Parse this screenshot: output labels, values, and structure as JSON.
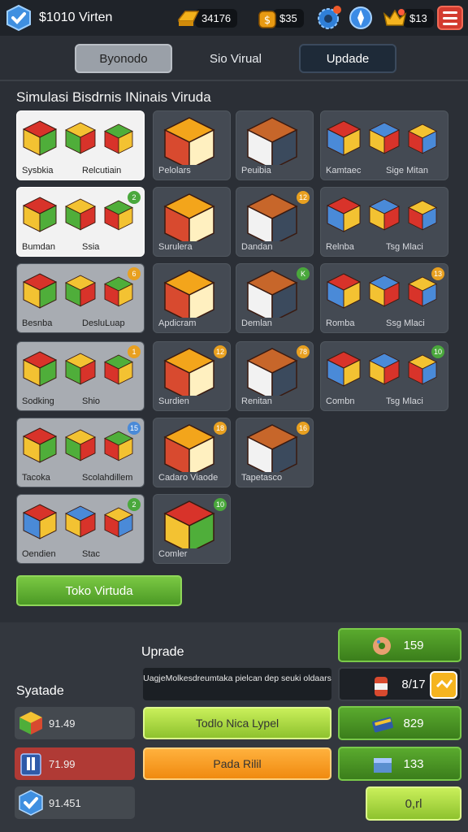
{
  "header": {
    "title": "$1010 Virten",
    "gold": "34176",
    "cash": "$35",
    "gems": "$13",
    "icons": [
      "verified-badge-icon",
      "gold-bar-icon",
      "coin-bag-icon",
      "settings-gear-icon",
      "compass-icon",
      "crown-coins-icon",
      "menu-icon"
    ]
  },
  "tabs": [
    {
      "label": "Byonodo"
    },
    {
      "label": "Sio Virual"
    },
    {
      "label": "Updade"
    }
  ],
  "section": {
    "title": "Simulasi Bisdrnis INinais Viruda"
  },
  "items": [
    {
      "labels": [
        "Sysbkia",
        "Relcutiain"
      ],
      "badge": ""
    },
    {
      "labels": [
        "Pelolars"
      ],
      "badge": ""
    },
    {
      "labels": [
        "Peuibia"
      ],
      "badge": ""
    },
    {
      "labels": [
        "Kamtaec",
        "Sige Mitan"
      ],
      "badge": ""
    },
    {
      "labels": [
        "Bumdan",
        "Ssia"
      ],
      "badge": "2"
    },
    {
      "labels": [
        "Surulera"
      ],
      "badge": ""
    },
    {
      "labels": [
        "Dandan"
      ],
      "badge": "12"
    },
    {
      "labels": [
        "Relnba",
        "Tsg Mlaci"
      ],
      "badge": ""
    },
    {
      "labels": [
        "Besnba",
        "DesluLuap"
      ],
      "badge": "6"
    },
    {
      "labels": [
        "Apdicram"
      ],
      "badge": ""
    },
    {
      "labels": [
        "Demlan"
      ],
      "badge": "K"
    },
    {
      "labels": [
        "Romba",
        "Ssg Mlaci"
      ],
      "badge": "13"
    },
    {
      "labels": [
        "Sodking",
        "Shio"
      ],
      "badge": "1"
    },
    {
      "labels": [
        "Surdien"
      ],
      "badge": "12"
    },
    {
      "labels": [
        "Renitan"
      ],
      "badge": "78"
    },
    {
      "labels": [
        "Combn",
        "Tsg Mlaci"
      ],
      "badge": "10"
    },
    {
      "labels": [
        "Tacoka",
        "Scolahdillem"
      ],
      "badge": "15"
    },
    {
      "labels": [
        "Cadaro Viaode"
      ],
      "badge": "18"
    },
    {
      "labels": [
        "Tapetasco"
      ],
      "badge": "16"
    },
    {
      "labels": [
        "Oendien",
        "Stac"
      ],
      "badge": "2"
    },
    {
      "labels": [
        "Comler"
      ],
      "badge": "10"
    }
  ],
  "main_button": "Toko Virtuda",
  "upgrade": {
    "title": "Uprade",
    "description": "UagjeMolkesdreumtaka pielcan dep seuki oldaars",
    "button_green": "Todlo Nica Lypel",
    "button_orange": "Pada Rilil"
  },
  "stats": {
    "title": "Syatade",
    "values": [
      "91.49",
      "71.99",
      "91.451"
    ]
  },
  "right_buttons": [
    "159",
    "8/17",
    "829",
    "133",
    "0,rl"
  ],
  "colors": {
    "background": "#2b2f36",
    "accent_green": "#5aaa2e",
    "accent_orange": "#f08a10",
    "accent_red": "#d33b2f"
  }
}
